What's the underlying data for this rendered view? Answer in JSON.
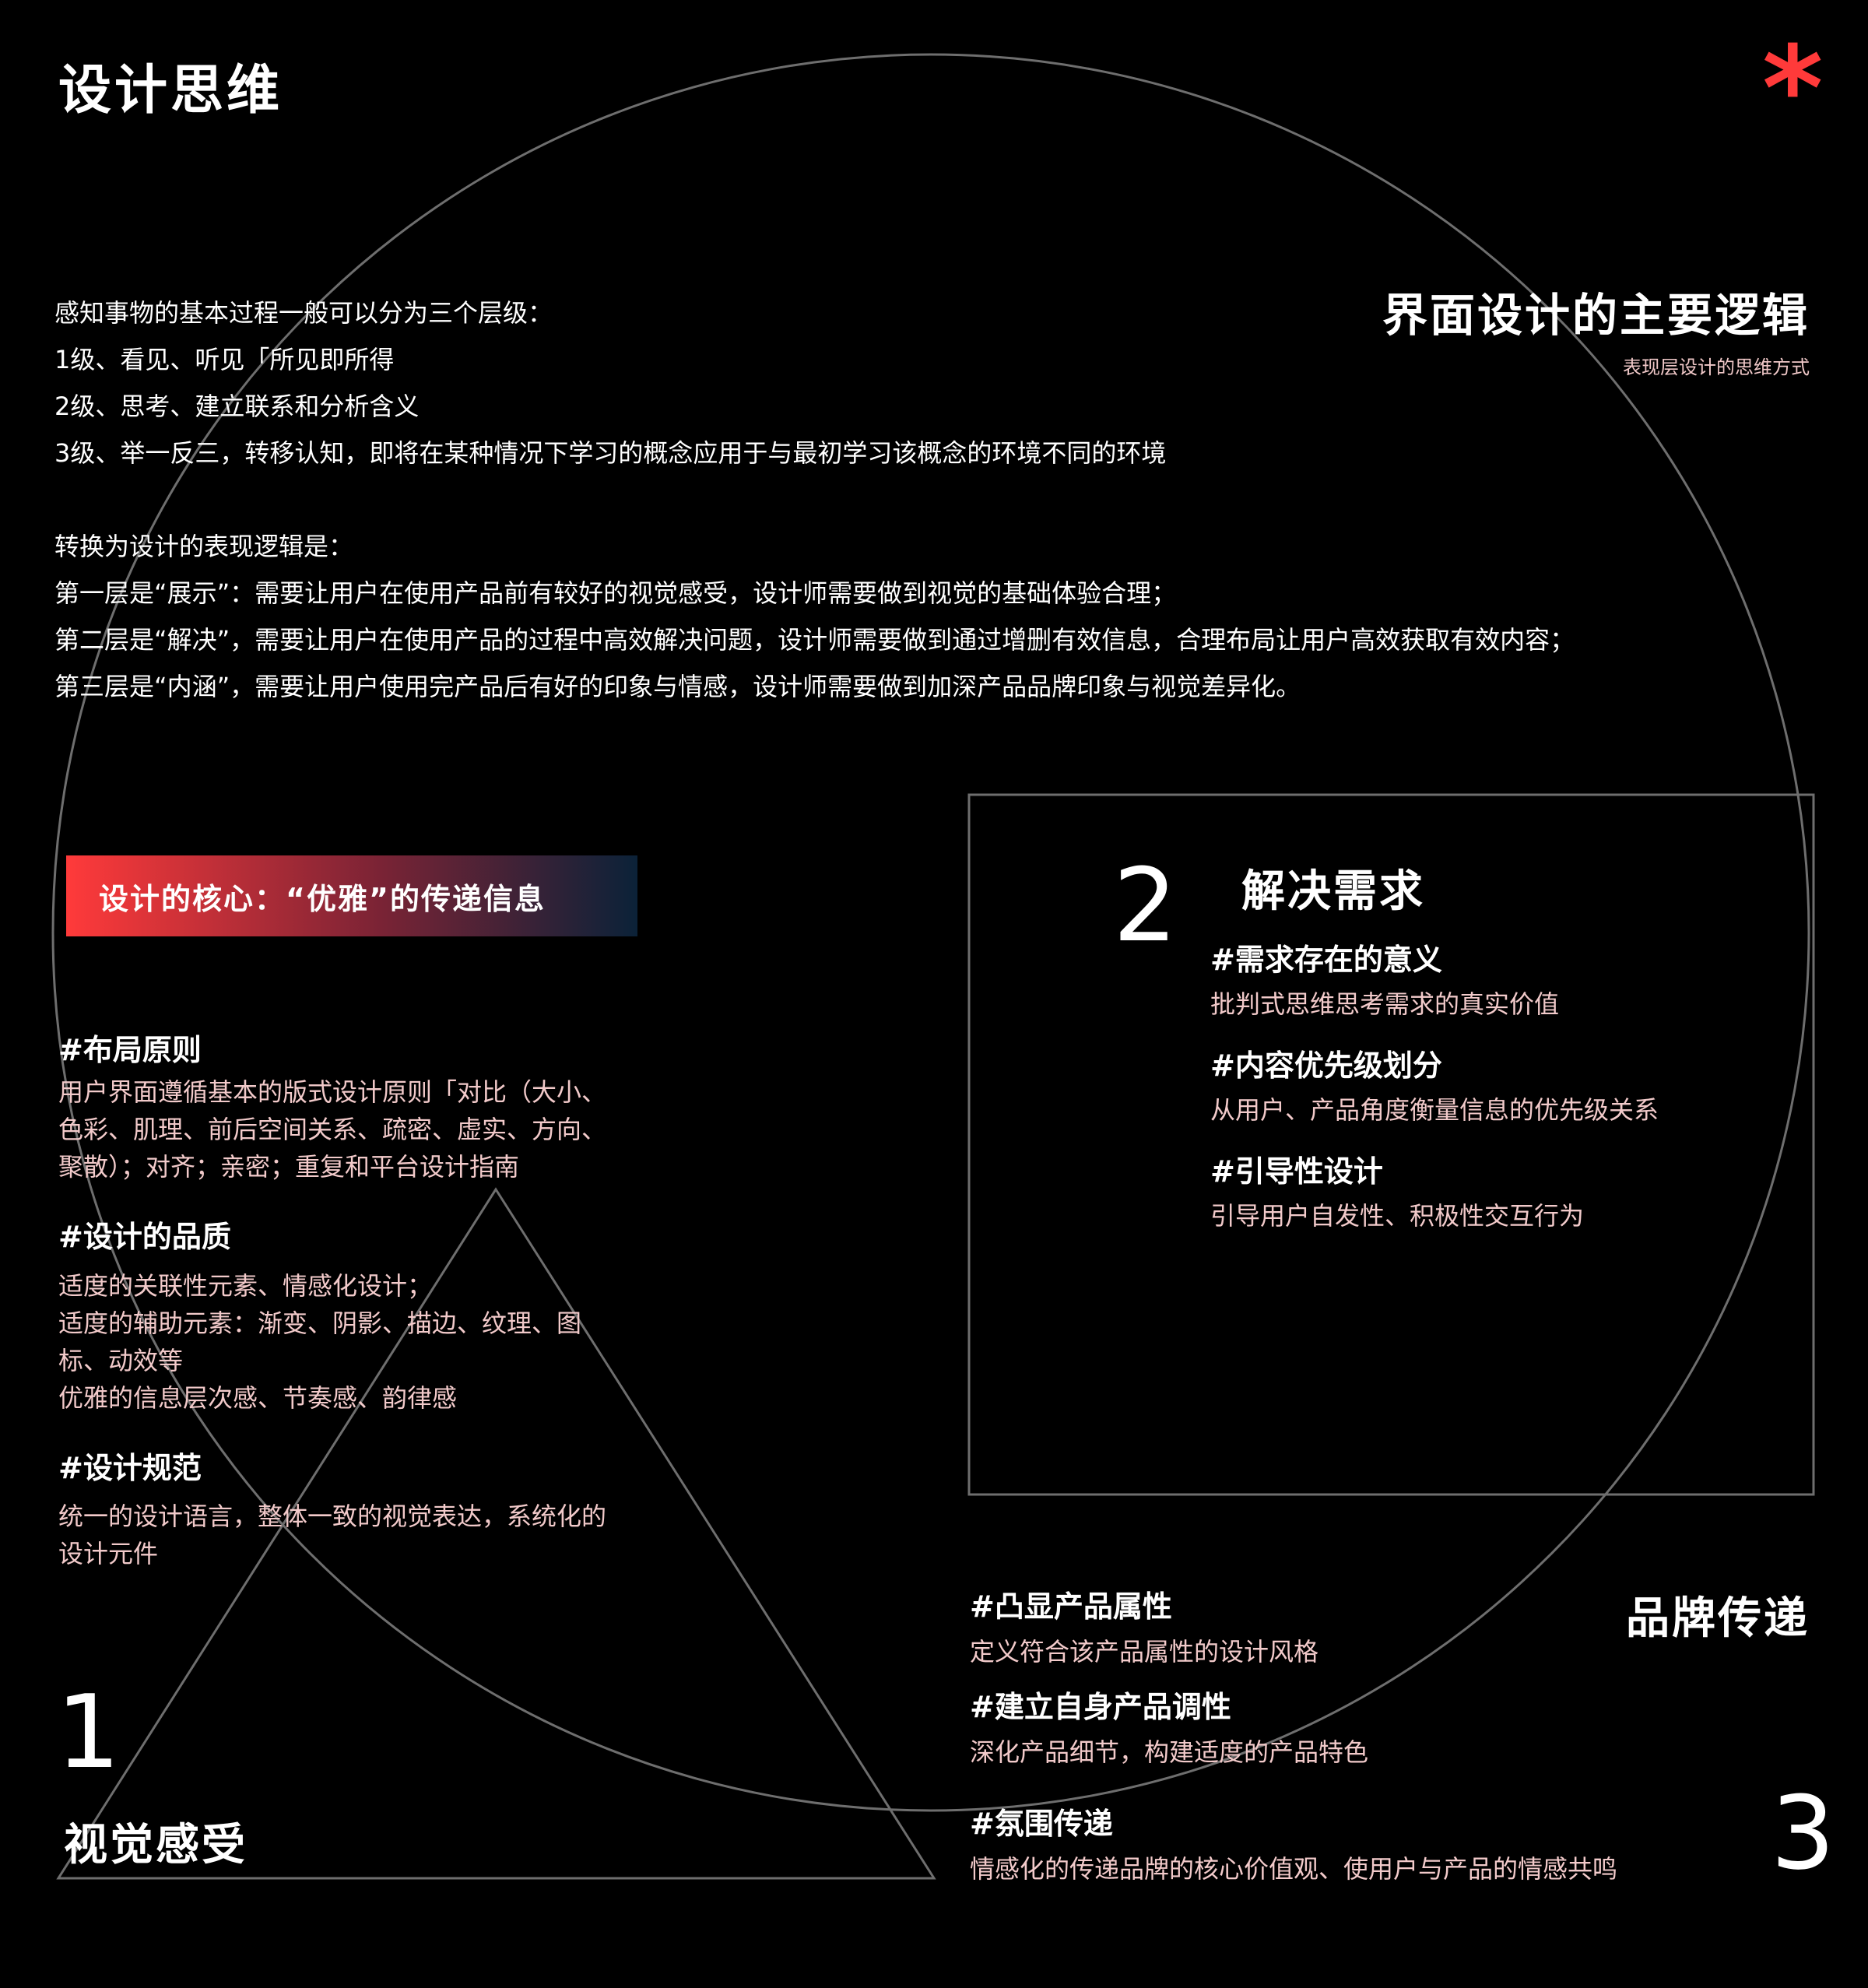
{
  "page": {
    "title": "设计思维",
    "accent_color": "#ff3a3a",
    "muted_text_color": "#f2caca",
    "line_color": "#6e6e6e",
    "asterisk": "*"
  },
  "logic": {
    "title": "界面设计的主要逻辑",
    "subtitle": "表现层设计的思维方式"
  },
  "intro": {
    "lines": [
      "感知事物的基本过程一般可以分为三个层级：",
      "1级、看见、听见「所见即所得",
      "2级、思考、建立联系和分析含义",
      "3级、举一反三，转移认知，即将在某种情况下学习的概念应用于与最初学习该概念的环境不同的环境",
      "",
      "转换为设计的表现逻辑是：",
      "第一层是“展示”：需要让用户在使用产品前有较好的视觉感受，设计师需要做到视觉的基础体验合理；",
      "第二层是“解决”，需要让用户在使用产品的过程中高效解决问题，设计师需要做到通过增删有效信息，合理布局让用户高效获取有效内容；",
      "第三层是“内涵”，需要让用户使用完产品后有好的印象与情感，设计师需要做到加深产品品牌印象与视觉差异化。"
    ]
  },
  "core": {
    "banner": "设计的核心：“优雅”的传递信息",
    "gradient": [
      "#ff3a3a",
      "#7a2335",
      "#0b2238"
    ]
  },
  "left_sections": [
    {
      "heading": "#布局原则",
      "lines": [
        "用户界面遵循基本的版式设计原则「对比（大小、",
        "色彩、肌理、前后空间关系、疏密、虚实、方向、",
        "聚散）；对齐；亲密；重复和平台设计指南"
      ]
    },
    {
      "heading": "#设计的品质",
      "lines": [
        "适度的关联性元素、情感化设计；",
        "适度的辅助元素：渐变、阴影、描边、纹理、图",
        "标、动效等",
        "优雅的信息层次感、节奏感、韵律感"
      ]
    },
    {
      "heading": "#设计规范",
      "lines": [
        "统一的设计语言，整体一致的视觉表达，系统化的",
        "设计元件"
      ]
    }
  ],
  "level1": {
    "number": "1",
    "title": "视觉感受"
  },
  "level2": {
    "number": "2",
    "title": "解决需求",
    "items": [
      {
        "heading": "#需求存在的意义",
        "text": "批判式思维思考需求的真实价值"
      },
      {
        "heading": "#内容优先级划分",
        "text": "从用户、产品角度衡量信息的优先级关系"
      },
      {
        "heading": "#引导性设计",
        "text": "引导用户自发性、积极性交互行为"
      }
    ]
  },
  "level3": {
    "number": "3",
    "title": "品牌传递",
    "items": [
      {
        "heading": "#凸显产品属性",
        "text": "定义符合该产品属性的设计风格"
      },
      {
        "heading": "#建立自身产品调性",
        "text": "深化产品细节，构建适度的产品特色"
      },
      {
        "heading": "#氛围传递",
        "text": "情感化的传递品牌的核心价值观、使用户与产品的情感共鸣"
      }
    ]
  }
}
